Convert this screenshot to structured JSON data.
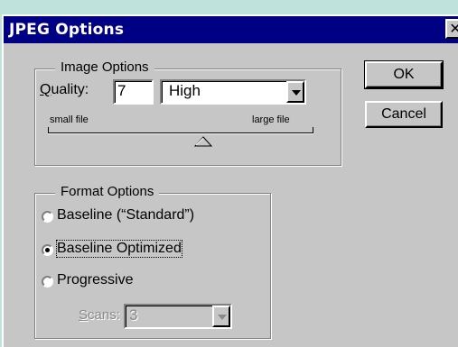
{
  "window": {
    "title": "JPEG Options",
    "close_glyph": "✕"
  },
  "image_options": {
    "legend": "Image Options",
    "quality_label": "Quality:",
    "quality_value": "7",
    "quality_level": "High",
    "slider_min_label": "small file",
    "slider_max_label": "large file",
    "slider_value": 7,
    "slider_max": 12
  },
  "format_options": {
    "legend": "Format Options",
    "options": [
      {
        "label": "Baseline (“Standard”)",
        "selected": false
      },
      {
        "label": "Baseline Optimized",
        "selected": true
      },
      {
        "label": "Progressive",
        "selected": false
      }
    ],
    "scans_label": "Scans:",
    "scans_value": "3"
  },
  "buttons": {
    "ok": "OK",
    "cancel": "Cancel"
  }
}
